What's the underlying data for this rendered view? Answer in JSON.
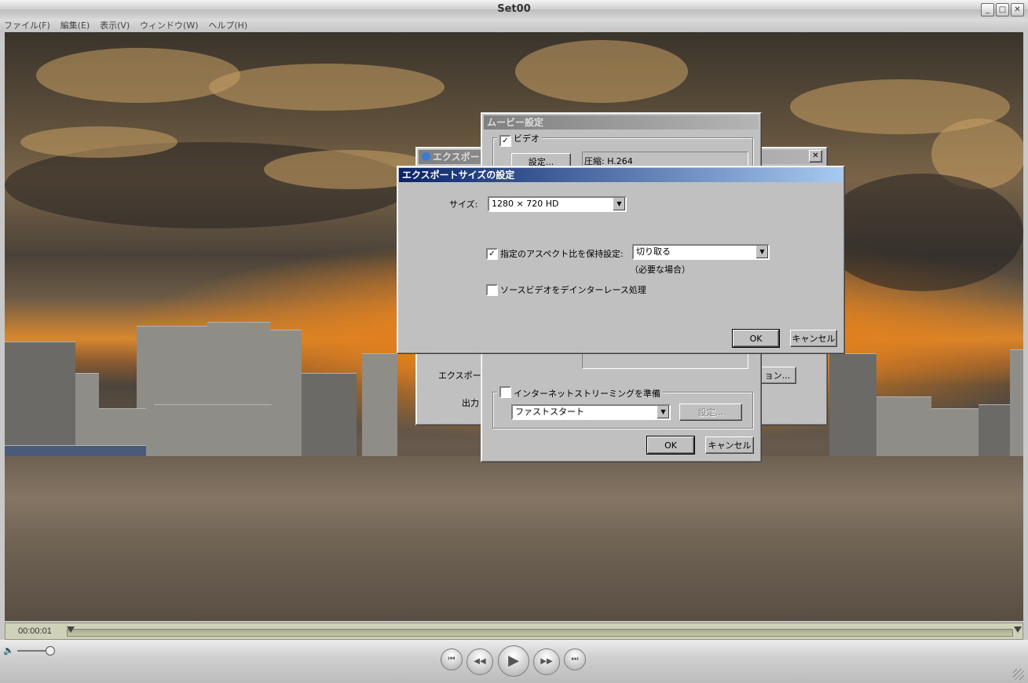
{
  "window": {
    "title": "Set00"
  },
  "menu": [
    "ファイル(F)",
    "編集(E)",
    "表示(V)",
    "ウィンドウ(W)",
    "ヘルプ(H)"
  ],
  "player": {
    "timecode": "00:00:01",
    "controls": {
      "back_to_start": "⏮",
      "rewind": "◀◀",
      "play": "▶",
      "fast_forward": "▶▶",
      "to_end": "⏭"
    },
    "volume_icon": "🔈"
  },
  "export_dialog": {
    "title": "エクスポート",
    "export_label": "エクスポート",
    "output_label": "出力",
    "close": "✕",
    "options_button": "ョン..."
  },
  "movie_settings": {
    "title": "ムービー設定",
    "video_label": "ビデオ",
    "video_checked": true,
    "settings_button": "設定...",
    "compression_info": "圧縮: H.264",
    "streaming_label": "インターネットストリーミングを準備",
    "streaming_checked": false,
    "streaming_mode": "ファストスタート",
    "streaming_settings_button": "設定...",
    "ok": "OK",
    "cancel": "キャンセル"
  },
  "export_size": {
    "title": "エクスポートサイズの設定",
    "size_label": "サイズ:",
    "size_value": "1280 × 720 HD",
    "keep_aspect_label": "指定のアスペクト比を保持",
    "keep_aspect_checked": true,
    "aspect_setting_label": "設定:",
    "aspect_setting_value": "切り取る",
    "aspect_note": "（必要な場合）",
    "deinterlace_label": "ソースビデオをデインターレース処理",
    "deinterlace_checked": false,
    "ok": "OK",
    "cancel": "キャンセル"
  },
  "icons": {
    "dropdown_arrow": "▼",
    "check": "✓",
    "minimize": "_",
    "maximize": "□",
    "close": "✕"
  }
}
